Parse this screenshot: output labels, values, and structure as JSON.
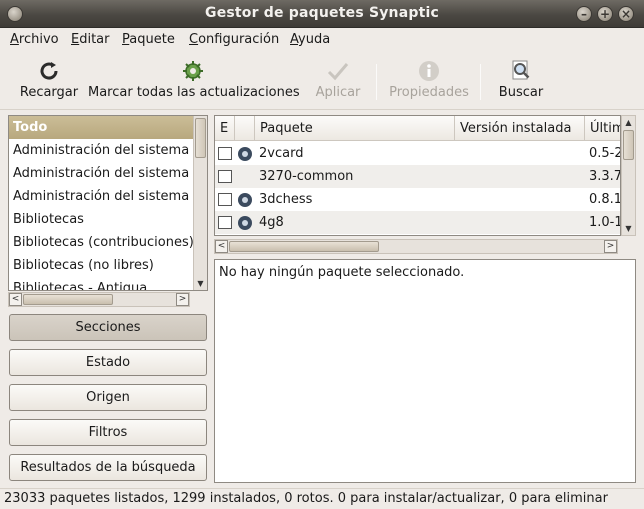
{
  "window": {
    "title": "Gestor de paquetes Synaptic"
  },
  "menubar": {
    "items": [
      "Archivo",
      "Editar",
      "Paquete",
      "Configuración",
      "Ayuda"
    ]
  },
  "toolbar": {
    "reload_label": "Recargar",
    "mark_all_label": "Marcar todas las actualizaciones",
    "apply_label": "Aplicar",
    "properties_label": "Propiedades",
    "search_label": "Buscar"
  },
  "sections": {
    "items": [
      "Todo",
      "Administración del sistema",
      "Administración del sistema",
      "Administración del sistema",
      "Bibliotecas",
      "Bibliotecas (contribuciones)",
      "Bibliotecas (no libres)",
      "Bibliotecas - Antigua"
    ],
    "selected_index": 0
  },
  "filter_buttons": {
    "sections": "Secciones",
    "status": "Estado",
    "origin": "Origen",
    "filters": "Filtros",
    "search_results": "Resultados de la búsqueda"
  },
  "package_table": {
    "columns": [
      "E",
      "",
      "Paquete",
      "Versión instalada",
      "Últim"
    ],
    "rows": [
      {
        "name": "2vcard",
        "installed": "",
        "latest": "0.5-2",
        "has_icon": true
      },
      {
        "name": "3270-common",
        "installed": "",
        "latest": "3.3.7",
        "has_icon": false
      },
      {
        "name": "3dchess",
        "installed": "",
        "latest": "0.8.1",
        "has_icon": true
      },
      {
        "name": "4g8",
        "installed": "",
        "latest": "1.0-1",
        "has_icon": true
      }
    ]
  },
  "details": {
    "text": "No hay ningún paquete seleccionado."
  },
  "statusbar": {
    "text": "23033 paquetes listados, 1299 instalados, 0 rotos. 0 para instalar/actualizar, 0 para eliminar"
  },
  "colors": {
    "selected_row": "#c5b893",
    "titlebar": "#4b4843"
  }
}
